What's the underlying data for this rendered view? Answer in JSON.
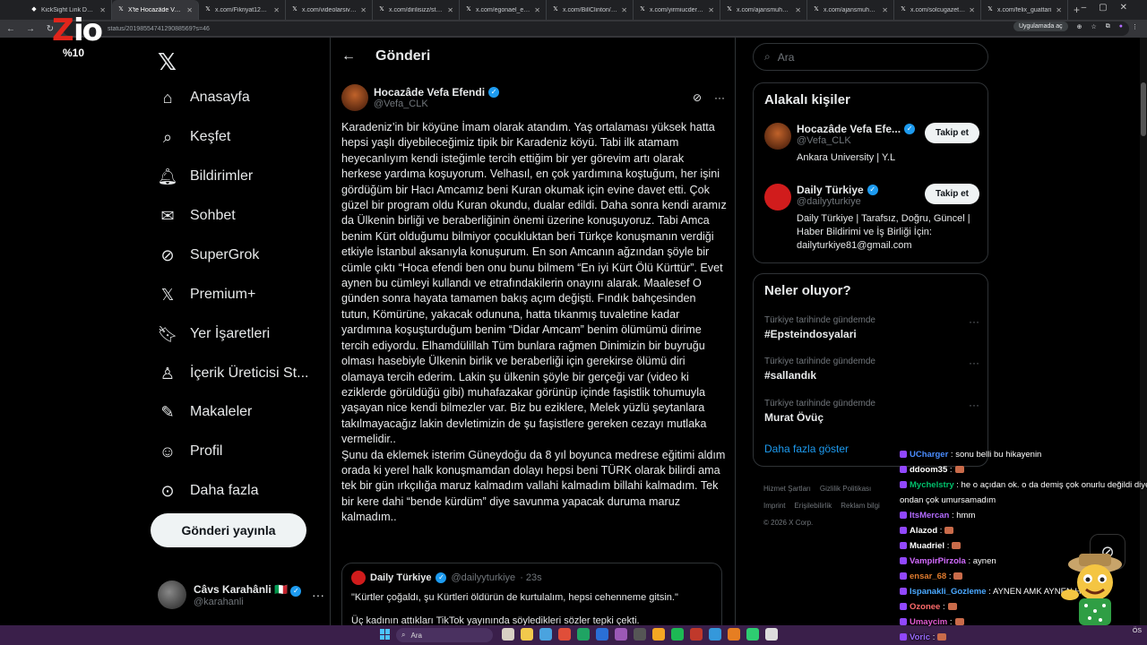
{
  "browser": {
    "tabs": [
      {
        "label": "KickSight Link Detecto",
        "active": false
      },
      {
        "label": "X'te Hocazâde Vefa Ef",
        "active": true
      },
      {
        "label": "x.com/Fikriyat123/stat",
        "active": false
      },
      {
        "label": "x.com/videolarsivi/stat",
        "active": false
      },
      {
        "label": "x.com/dirilisizz/statu",
        "active": false
      },
      {
        "label": "x.com/egonael_ego/st",
        "active": false
      },
      {
        "label": "x.com/BillClinton/stat",
        "active": false
      },
      {
        "label": "x.com/yirmiucderece",
        "active": false
      },
      {
        "label": "x.com/ajansmuhbir19",
        "active": false
      },
      {
        "label": "x.com/ajansmuhbir19",
        "active": false
      },
      {
        "label": "x.com/solcugazete60",
        "active": false
      },
      {
        "label": "x.com/felix_guattari",
        "active": false
      }
    ],
    "url": "status/2019855474129088569?s=46",
    "app_button": "Uygulamada aç"
  },
  "overlay_logo": {
    "letters_red": "Z",
    "letters_white": "io",
    "percent": "%10"
  },
  "nav": {
    "items": [
      {
        "label": "Anasayfa",
        "icon": "home-icon"
      },
      {
        "label": "Keşfet",
        "icon": "search-icon"
      },
      {
        "label": "Bildirimler",
        "icon": "bell-icon"
      },
      {
        "label": "Sohbet",
        "icon": "mail-icon"
      },
      {
        "label": "SuperGrok",
        "icon": "grok-icon"
      },
      {
        "label": "Premium+",
        "icon": "x-icon"
      },
      {
        "label": "Yer İşaretleri",
        "icon": "bookmark-icon"
      },
      {
        "label": "İçerik Üreticisi St...",
        "icon": "creator-icon"
      },
      {
        "label": "Makaleler",
        "icon": "articles-icon"
      },
      {
        "label": "Profil",
        "icon": "user-icon"
      },
      {
        "label": "Daha fazla",
        "icon": "more-circle-icon"
      }
    ],
    "post_button": "Gönderi yayınla",
    "account": {
      "name": "Câvs Karahânli 🇮🇹",
      "handle": "@karahanli"
    }
  },
  "post": {
    "header_title": "Gönderi",
    "author_name": "Hocazâde Vefa Efendi",
    "author_handle": "@Vefa_CLK",
    "text": "Karadeniz’in bir köyüne İmam olarak atandım. Yaş ortalaması yüksek hatta hepsi yaşlı diyebileceğimiz tipik bir Karadeniz köyü. Tabi ilk atamam heyecanlıyım kendi isteğimle tercih ettiğim bir yer görevim artı olarak herkese yardıma koşuyorum. Velhasıl, en çok yardımına koştuğum, her işini gördüğüm bir Hacı Amcamız beni Kuran okumak için evine davet etti. Çok güzel bir program oldu Kuran okundu, dualar edildi. Daha sonra kendi aramız da Ülkenin birliği ve beraberliğinin önemi üzerine konuşuyoruz. Tabi Amca benim Kürt olduğumu bilmiyor çocukluktan beri Türkçe konuşmanın verdiği etkiyle İstanbul aksanıyla konuşurum. En son Amcanın ağzından şöyle bir cümle çıktı “Hoca efendi ben onu bunu bilmem “En iyi Kürt Ölü Kürttür”. Evet aynen bu cümleyi kullandı ve etrafındakilerin onayını alarak. Maalesef O günden sonra hayata tamamen bakış açım değişti. Fındık bahçesinden tutun, Kömürüne, yakacak odununa, hatta tıkanmış tuvaletine kadar yardımına koşuşturduğum benim “Didar Amcam” benim ölümümü dirime tercih ediyordu. Elhamdülillah Tüm bunlara rağmen Dinimizin bir buyruğu olması hasebiyle Ülkenin birlik ve beraberliği için gerekirse ölümü diri olamaya tercih ederim. Lakin şu ülkenin şöyle bir gerçeği var (video ki eziklerde görüldüğü gibi) muhafazakar görünüp içinde faşistlik tohumuyla yaşayan nice kendi bilmezler var. Biz bu eziklere, Melek yüzlü şeytanlara takılmayacağız lakin devletimizin de şu faşistlere gereken cezayı mutlaka vermelidir..\nŞunu da eklemek isterim Güneydoğu da 8 yıl boyunca medrese eğitimi aldım orada ki yerel halk konuşmamdan dolayı hepsi beni TÜRK olarak bilirdi ama tek bir gün ırkçılığa maruz kalmadım vallahi kalmadım billahi kalmadım. Tek bir kere dahi “bende kürdüm” diye savunma yapacak duruma maruz kalmadım..",
    "quote": {
      "name": "Daily Türkiye",
      "handle": "@dailyyturkiye",
      "time": "· 23s",
      "text": "\"Kürtler çoğaldı, şu Kürtleri öldürün de kurtulalım, hepsi cehenneme gitsin.\"",
      "text2": "Üç kadının attıkları TikTok yayınında söyledikleri sözler tepki çekti."
    }
  },
  "right": {
    "search_placeholder": "Ara",
    "related_title": "Alakalı kişiler",
    "people": [
      {
        "name": "Hocazâde Vefa Efe...",
        "handle": "@Vefa_CLK",
        "bio": "Ankara University | Y.L",
        "button": "Takip et"
      },
      {
        "name": "Daily Türkiye",
        "handle": "@dailyyturkiye",
        "bio": "Daily Türkiye | Tarafsız, Doğru, Güncel | Haber Bildirimi ve İş Birliği İçin: dailyturkiye81@gmail.com",
        "button": "Takip et"
      }
    ],
    "trends_title": "Neler oluyor?",
    "trends": [
      {
        "context": "Türkiye tarihinde gündemde",
        "name": "#Epsteindosyalari"
      },
      {
        "context": "Türkiye tarihinde gündemde",
        "name": "#sallandık"
      },
      {
        "context": "Türkiye tarihinde gündemde",
        "name": "Murat Övüç"
      }
    ],
    "show_more": "Daha fazla göster",
    "footer": [
      "Hizmet Şartları",
      "Gizlilik Politikası",
      "Imprint",
      "Erişilebilirlik",
      "Reklam bilgi",
      "© 2026 X Corp."
    ]
  },
  "chat": [
    {
      "user": "UCharger",
      "color": "#4a8cff",
      "msg": " : sonu belli bu hikayenin"
    },
    {
      "user": "ddoom35",
      "color": "#ffffff",
      "msg": " :"
    },
    {
      "user": "Mychelstry",
      "color": "#00c06b",
      "msg": " : he o açıdan ok. o da demiş çok onurlu değildi diye"
    },
    {
      "user": "",
      "color": "#ffffff",
      "msg": "ondan çok umursamadım"
    },
    {
      "user": "ItsMercan",
      "color": "#b36bff",
      "msg": " : hmm"
    },
    {
      "user": "Alazod",
      "color": "#ffffff",
      "msg": " :"
    },
    {
      "user": "Muadriel",
      "color": "#ffffff",
      "msg": " :"
    },
    {
      "user": "VampirPirzola",
      "color": "#d26bff",
      "msg": " : aynen"
    },
    {
      "user": "ensar_68",
      "color": "#e07b2e",
      "msg": " :"
    },
    {
      "user": "Ispanakli_Gozleme",
      "color": "#4aa8ff",
      "msg": " : AYNEN AMK AYNEN HEEE"
    },
    {
      "user": "Ozonee",
      "color": "#ff6b6b",
      "msg": " :"
    },
    {
      "user": "Umaycim",
      "color": "#e05ad0",
      "msg": " :"
    },
    {
      "user": "Voric",
      "color": "#9b6bff",
      "msg": " :"
    }
  ],
  "taskbar": {
    "search_placeholder": "Ara",
    "tray": "ÖS"
  }
}
